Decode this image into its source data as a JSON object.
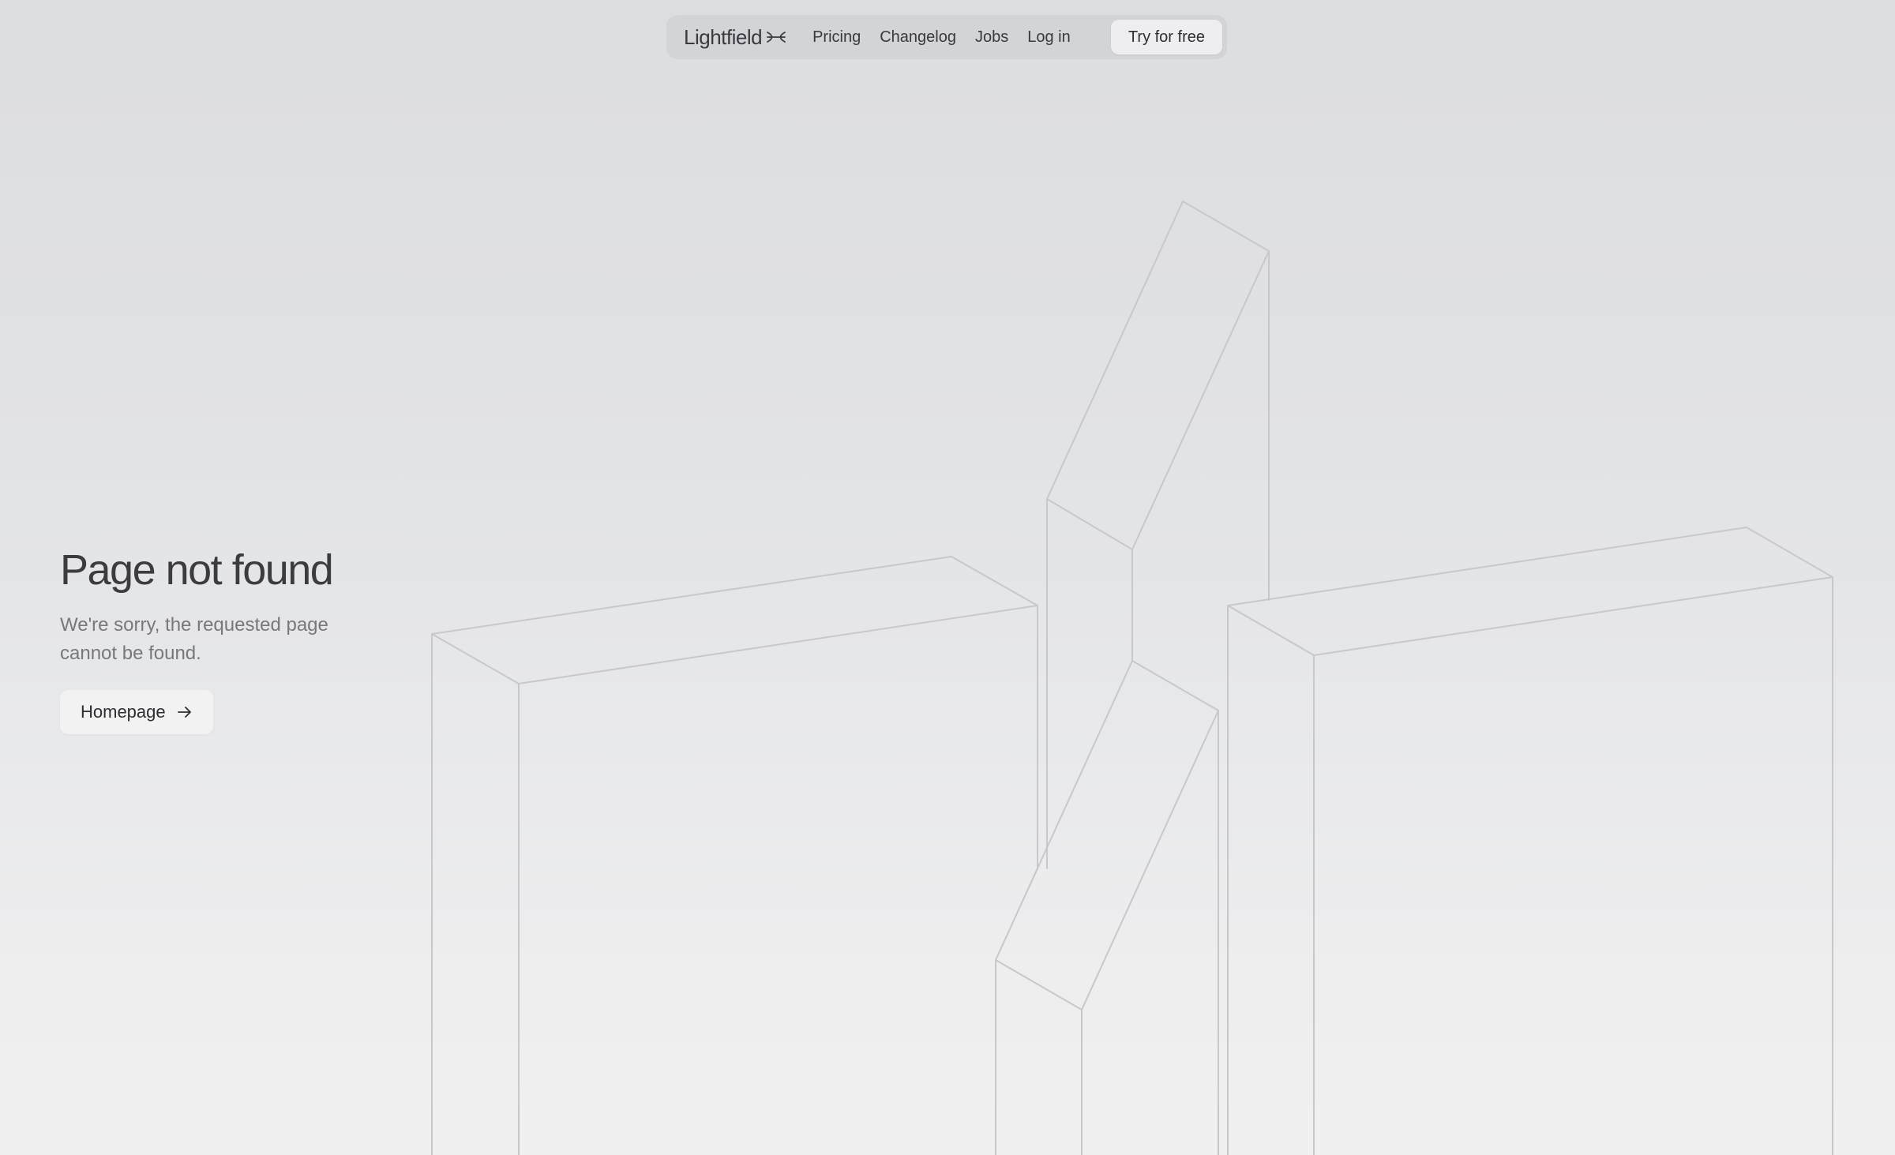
{
  "nav": {
    "logo_text": "Lightfield",
    "links": [
      "Pricing",
      "Changelog",
      "Jobs",
      "Log in"
    ],
    "cta_label": "Try for free"
  },
  "hero": {
    "title": "Page not found",
    "subtitle": "We're sorry, the requested page cannot be found.",
    "button_label": "Homepage",
    "button_icon": "arrow-right-icon"
  },
  "colors": {
    "background_top": "#dcdde1",
    "background_bottom": "#f0f0f0",
    "text_primary": "#3c3c40",
    "text_secondary": "#77777c",
    "outline": "#c8c8cb"
  },
  "illustration": {
    "description_icon": "isometric-blocks-illustration"
  }
}
